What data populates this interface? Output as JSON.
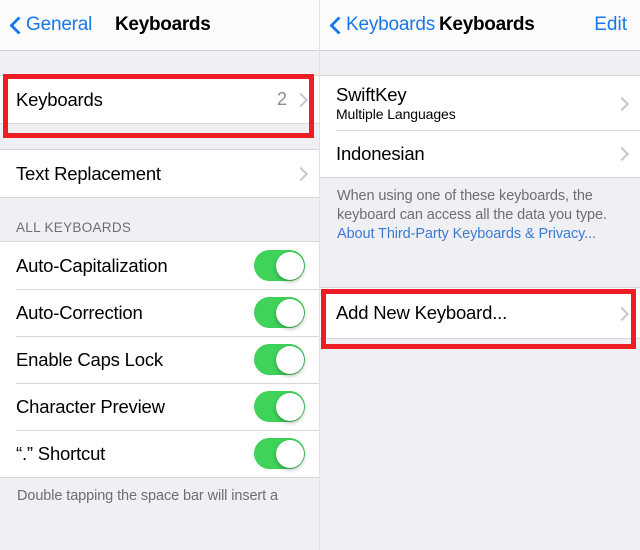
{
  "left_panel": {
    "nav": {
      "back_label": "General",
      "title": "Keyboards"
    },
    "keyboards_row": {
      "label": "Keyboards",
      "value": "2"
    },
    "text_replacement_row": {
      "label": "Text Replacement"
    },
    "section_header": "ALL KEYBOARDS",
    "toggle_rows": [
      {
        "label": "Auto-Capitalization",
        "state": "on"
      },
      {
        "label": "Auto-Correction",
        "state": "on"
      },
      {
        "label": "Enable Caps Lock",
        "state": "on"
      },
      {
        "label": "Character Preview",
        "state": "on"
      },
      {
        "label": "“.” Shortcut",
        "state": "on"
      }
    ],
    "footer_text": "Double tapping the space bar will insert a"
  },
  "right_panel": {
    "nav": {
      "back_label": "Keyboards",
      "title": "Keyboards",
      "edit_label": "Edit"
    },
    "keyboard_items": [
      {
        "title": "SwiftKey",
        "subtitle": "Multiple Languages"
      },
      {
        "title": "Indonesian",
        "subtitle": ""
      }
    ],
    "privacy_footer": {
      "text": "When using one of these keyboards, the keyboard can access all the data you type. ",
      "link": "About Third-Party Keyboards & Privacy..."
    },
    "add_keyboard_row": {
      "label": "Add New Keyboard..."
    }
  },
  "annotations": {
    "highlight_color": "#ee1c23",
    "boxes": [
      {
        "name": "keyboards-row-highlight"
      },
      {
        "name": "add-new-keyboard-highlight"
      }
    ]
  },
  "colors": {
    "accent_blue": "#1778e8",
    "link_blue": "#3b7cd3",
    "toggle_green": "#3fd35a",
    "group_background": "#efeff4",
    "row_background": "#ffffff",
    "secondary_text": "#6d6d72"
  }
}
